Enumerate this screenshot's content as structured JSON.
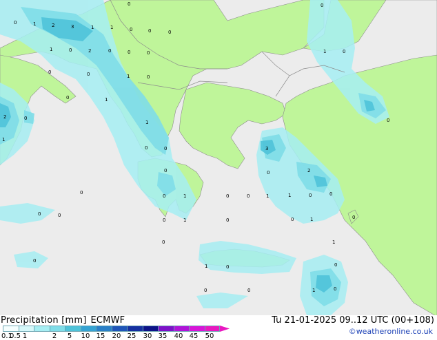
{
  "map": {
    "colors": {
      "sea": "#ececec",
      "land": "#bff59a",
      "precip_light": "#a6eef3",
      "precip_medium": "#7fdde8",
      "precip_heavy": "#4fc3d9",
      "border": "#8c8c8c"
    },
    "value_labels": [
      {
        "text": "0"
      },
      {
        "text": "1"
      },
      {
        "text": "2"
      },
      {
        "text": "3"
      },
      {
        "text": "1"
      },
      {
        "text": "1"
      },
      {
        "text": "0"
      },
      {
        "text": "0"
      },
      {
        "text": "0"
      },
      {
        "text": "0"
      },
      {
        "text": "1"
      },
      {
        "text": "0"
      },
      {
        "text": "2"
      },
      {
        "text": "0"
      },
      {
        "text": "0"
      },
      {
        "text": "0"
      },
      {
        "text": "0"
      },
      {
        "text": "1"
      },
      {
        "text": "0"
      },
      {
        "text": "0"
      },
      {
        "text": "2"
      },
      {
        "text": "0"
      },
      {
        "text": "1"
      },
      {
        "text": "0"
      },
      {
        "text": "1"
      },
      {
        "text": "1"
      },
      {
        "text": "0"
      },
      {
        "text": "0"
      },
      {
        "text": "0"
      },
      {
        "text": "3"
      },
      {
        "text": "2"
      },
      {
        "text": "0"
      },
      {
        "text": "0"
      },
      {
        "text": "1"
      },
      {
        "text": "0"
      },
      {
        "text": "0"
      },
      {
        "text": "0"
      },
      {
        "text": "1"
      },
      {
        "text": "0"
      },
      {
        "text": "0"
      },
      {
        "text": "1"
      },
      {
        "text": "0"
      },
      {
        "text": "0"
      },
      {
        "text": "0"
      },
      {
        "text": "1"
      },
      {
        "text": "0"
      },
      {
        "text": "0"
      },
      {
        "text": "1"
      },
      {
        "text": "0"
      },
      {
        "text": "1"
      },
      {
        "text": "0"
      },
      {
        "text": "1"
      },
      {
        "text": "0"
      },
      {
        "text": "0"
      },
      {
        "text": "0"
      },
      {
        "text": "0"
      },
      {
        "text": "1"
      },
      {
        "text": "0"
      },
      {
        "text": "0"
      },
      {
        "text": "1"
      },
      {
        "text": "0"
      },
      {
        "text": "0"
      },
      {
        "text": "0"
      }
    ]
  },
  "footer": {
    "title": "Precipitation [mm]",
    "model": "ECMWF",
    "valid_time": "Tu 21-01-2025 09..12 UTC (00+108)",
    "copyright": "©weatheronline.co.uk"
  },
  "legend": {
    "ticks": [
      "0.1",
      "0.5",
      "1",
      "2",
      "5",
      "10",
      "15",
      "20",
      "25",
      "30",
      "35",
      "40",
      "45",
      "50"
    ],
    "colors": [
      "#f5fefe",
      "#d6f8fa",
      "#a6eef3",
      "#7fdde8",
      "#4fc3d9",
      "#35a3d3",
      "#2a7fc7",
      "#1f55b8",
      "#1530a0",
      "#0e1488",
      "#7d12c8",
      "#b014d8",
      "#d815d8",
      "#e818c0"
    ]
  }
}
